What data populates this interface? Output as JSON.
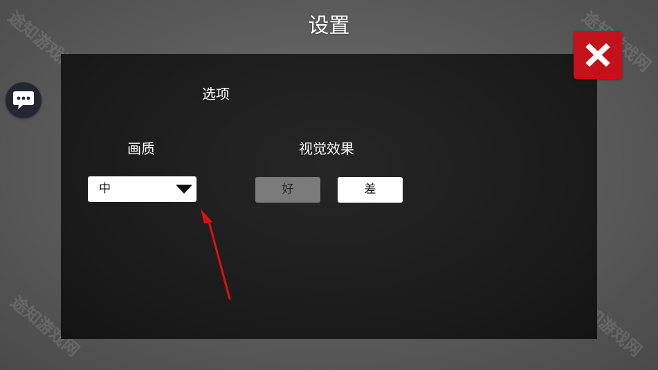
{
  "header": {
    "title": "设置"
  },
  "close_button": {
    "icon": "close-icon",
    "color": "#c4121c"
  },
  "chat_button": {
    "icon": "chat-bubble-icon"
  },
  "panel": {
    "options_label": "选项",
    "quality": {
      "label": "画质",
      "selected": "中",
      "icon": "triangle-down-icon"
    },
    "visual_effects": {
      "label": "视觉效果",
      "options": [
        {
          "label": "好",
          "selected": true
        },
        {
          "label": "差",
          "selected": false
        }
      ]
    }
  },
  "annotation": {
    "icon": "red-arrow-icon",
    "color": "#e01010"
  },
  "watermark": {
    "text": "途知游戏网"
  }
}
